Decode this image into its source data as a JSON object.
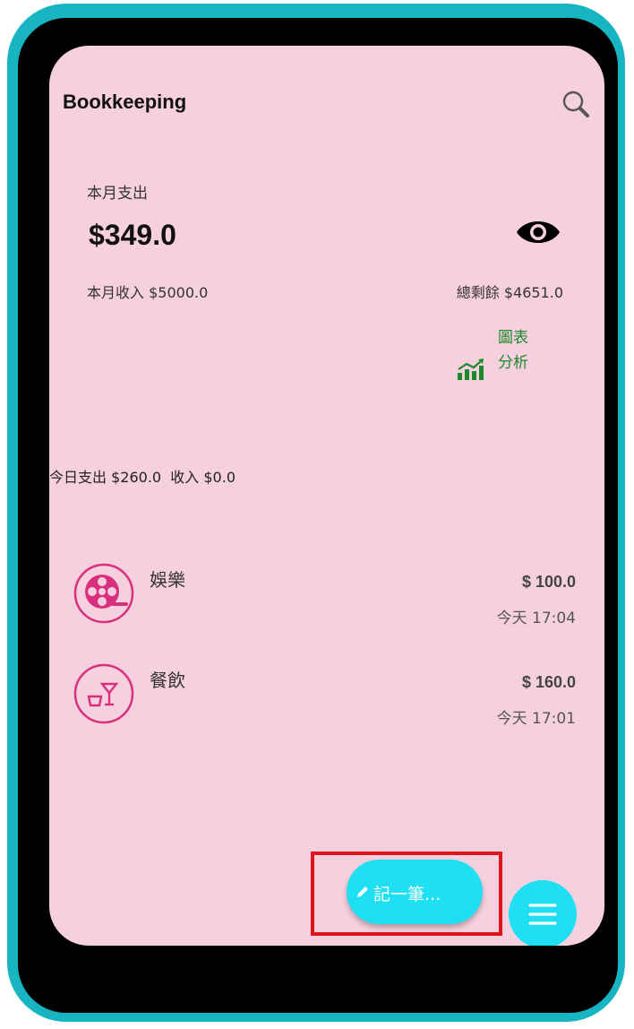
{
  "header": {
    "title": "Bookkeeping",
    "search_icon": "search-icon"
  },
  "summary": {
    "month_spend_label": "本月支出",
    "month_spend_value": "$349.0",
    "eye_icon": "eye-icon",
    "month_income_label": "本月收入",
    "month_income_value": "$5000.0",
    "balance_label": "總剩餘",
    "balance_value": "$4651.0"
  },
  "chart_link": {
    "line1": "圖表",
    "line2": "分析",
    "icon": "chart-growth-icon",
    "color": "#1c8a2c"
  },
  "today": {
    "spend_label": "今日支出",
    "spend_value": "$260.0",
    "income_label": "收入",
    "income_value": "$0.0"
  },
  "transactions": [
    {
      "category": "娛樂",
      "amount": "$ 100.0",
      "time": "今天 17:04",
      "icon": "film-reel-icon"
    },
    {
      "category": "餐飲",
      "amount": "$ 160.0",
      "time": "今天 17:01",
      "icon": "food-drink-icon"
    }
  ],
  "actions": {
    "add_label": "記一筆...",
    "add_icon": "pencil-icon",
    "menu_icon": "menu-icon"
  },
  "colors": {
    "screen_bg": "#f6d0de",
    "accent": "#1ee0f2",
    "frame": "#17b5c2",
    "icon_pink": "#d9307e",
    "highlight": "#e1141e"
  }
}
